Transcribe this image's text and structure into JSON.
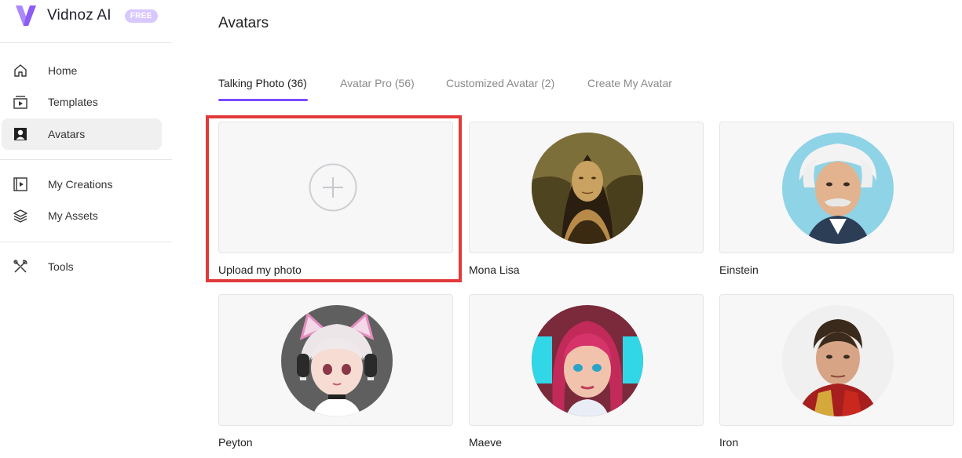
{
  "brand": {
    "name": "Vidnoz AI",
    "badge": "FREE"
  },
  "nav": {
    "items": [
      {
        "label": "Home",
        "icon": "home-icon"
      },
      {
        "label": "Templates",
        "icon": "templates-icon"
      },
      {
        "label": "Avatars",
        "icon": "avatar-icon",
        "active": true
      },
      {
        "label": "My Creations",
        "icon": "play-icon"
      },
      {
        "label": "My Assets",
        "icon": "layers-icon"
      },
      {
        "label": "Tools",
        "icon": "tools-icon"
      }
    ]
  },
  "page": {
    "title": "Avatars"
  },
  "tabs": [
    {
      "label": "Talking Photo (36)",
      "active": true
    },
    {
      "label": "Avatar Pro (56)"
    },
    {
      "label": "Customized Avatar (2)"
    },
    {
      "label": "Create My Avatar"
    }
  ],
  "cards": [
    {
      "label": "Upload my photo",
      "type": "upload",
      "icon": "plus-icon"
    },
    {
      "label": "Mona Lisa"
    },
    {
      "label": "Einstein"
    },
    {
      "label": "Peyton"
    },
    {
      "label": "Maeve"
    },
    {
      "label": "Iron"
    }
  ],
  "colors": {
    "accent": "#7b4dff",
    "highlight": "#e23a3a",
    "badge": "#d9c8ff"
  }
}
